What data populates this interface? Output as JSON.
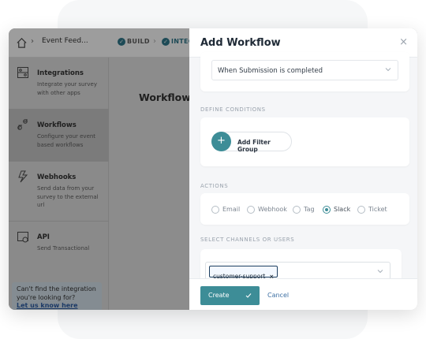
{
  "topbar": {
    "breadcrumb_page": "Event Feed...",
    "step_build": "BUILD",
    "step_integrate": "INTEG"
  },
  "sidebar": {
    "items": [
      {
        "title": "Integrations",
        "desc": "Integrate your survey with other apps",
        "icon": "integrations-icon"
      },
      {
        "title": "Workflows",
        "desc": "Configure your event based workflows",
        "icon": "workflows-icon"
      },
      {
        "title": "Webhooks",
        "desc": "Send data from your survey to the external url",
        "icon": "webhooks-icon"
      },
      {
        "title": "API",
        "desc": "Send Transactional",
        "icon": "api-icon"
      }
    ],
    "help_text": "Can't find the integration you're looking for?",
    "help_link": "Let us know here"
  },
  "main": {
    "title": "Workflows"
  },
  "modal": {
    "title": "Add Workflow",
    "trigger_value": "When Submission is completed",
    "conditions_label": "DEFINE CONDITIONS",
    "add_filter_label": "Add Filter Group",
    "actions_label": "ACTIONS",
    "actions": [
      {
        "label": "Email",
        "checked": false
      },
      {
        "label": "Webhook",
        "checked": false
      },
      {
        "label": "Tag",
        "checked": false
      },
      {
        "label": "Slack",
        "checked": true
      },
      {
        "label": "Ticket",
        "checked": false
      }
    ],
    "channels_label": "SELECT CHANNELS OR USERS",
    "selected_channel": "customer-support",
    "create_label": "Create",
    "cancel_label": "Cancel"
  },
  "colors": {
    "accent": "#3d8d97",
    "link": "#3d6fa3"
  }
}
